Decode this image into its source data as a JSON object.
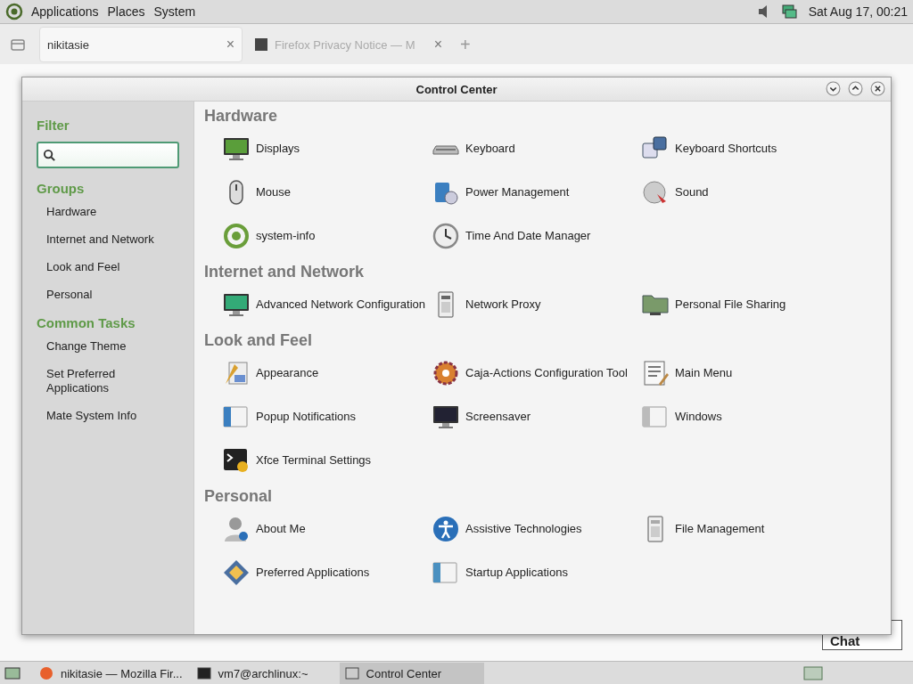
{
  "top_panel": {
    "menus": [
      "Applications",
      "Places",
      "System"
    ],
    "clock": "Sat Aug 17, 00:21"
  },
  "browser": {
    "tabs": [
      {
        "label": "nikitasie",
        "selected": true,
        "close": "×"
      },
      {
        "label": "Firefox Privacy Notice — M",
        "selected": false,
        "close": "×"
      }
    ],
    "new_tab": "+",
    "chat_button": "Chat"
  },
  "window": {
    "title": "Control Center",
    "sidebar": {
      "filter_heading": "Filter",
      "sections": [
        {
          "heading": "Groups",
          "items": [
            "Hardware",
            "Internet and Network",
            "Look and Feel",
            "Personal"
          ]
        },
        {
          "heading": "Common Tasks",
          "items": [
            "Change Theme",
            "Set Preferred Applications",
            "Mate System Info"
          ]
        }
      ]
    },
    "sections": [
      {
        "title": "Hardware",
        "items": [
          "Displays",
          "Keyboard",
          "Keyboard Shortcuts",
          "Mouse",
          "Power Management",
          "Sound",
          "system-info",
          "Time And Date Manager"
        ]
      },
      {
        "title": "Internet and Network",
        "items": [
          "Advanced Network Configuration",
          "Network Proxy",
          "Personal File Sharing"
        ]
      },
      {
        "title": "Look and Feel",
        "items": [
          "Appearance",
          "Caja-Actions Configuration Tool",
          "Main Menu",
          "Popup Notifications",
          "Screensaver",
          "Windows",
          "Xfce Terminal Settings"
        ]
      },
      {
        "title": "Personal",
        "items": [
          "About Me",
          "Assistive Technologies",
          "File Management",
          "Preferred Applications",
          "Startup Applications"
        ]
      }
    ]
  },
  "taskbar": [
    {
      "label": "nikitasie — Mozilla Fir...",
      "selected": false
    },
    {
      "label": "vm7@archlinux:~",
      "selected": false
    },
    {
      "label": "Control Center",
      "selected": true
    }
  ]
}
